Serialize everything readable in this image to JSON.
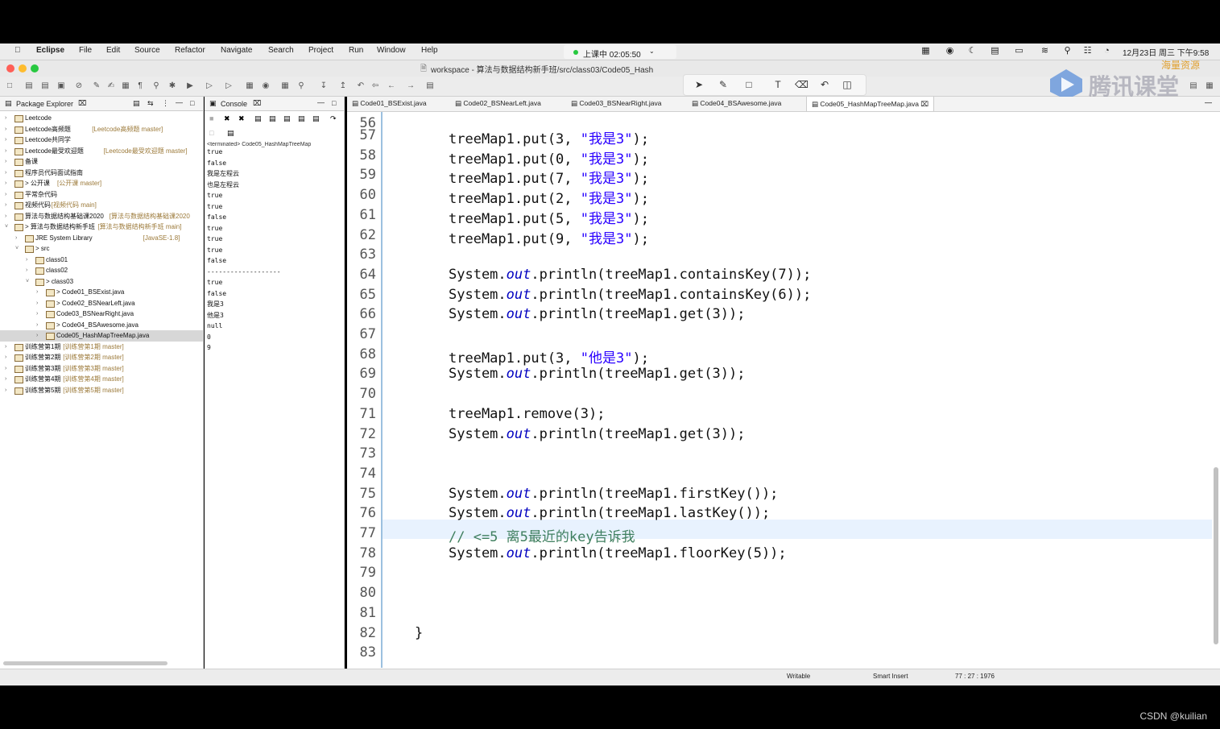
{
  "menubar": {
    "app": "Eclipse",
    "items": [
      "File",
      "Edit",
      "Source",
      "Refactor",
      "Navigate",
      "Search",
      "Project",
      "Run",
      "Window",
      "Help"
    ],
    "clock": "12月23日 周三 下午9:58"
  },
  "recording": {
    "label": "上课中 02:05:50"
  },
  "window": {
    "title": "workspace - 算法与数据结构新手班/src/class03/Code05_Hash"
  },
  "watermark": {
    "brand": "腾讯课堂",
    "sub": "海量资源"
  },
  "package_explorer": {
    "tab_label": "Package Explorer",
    "items": [
      {
        "text": "Leetcode",
        "extra": ""
      },
      {
        "text": "Leetcode高频题",
        "extra": "[Leetcode高频题 master]"
      },
      {
        "text": "Leetcode共同学",
        "extra": ""
      },
      {
        "text": "Leetcode最受欢迎题",
        "extra": "[Leetcode最受欢迎题 master]"
      },
      {
        "text": "备课",
        "extra": ""
      },
      {
        "text": "程序员代码面试指南",
        "extra": ""
      },
      {
        "text": "> 公开课",
        "extra": "[公开课 master]"
      },
      {
        "text": "平常杂代码",
        "extra": ""
      },
      {
        "text": "视频代码",
        "extra": "[视频代码 main]"
      },
      {
        "text": "算法与数据结构基础课2020",
        "extra": "[算法与数据结构基础课2020"
      },
      {
        "text": "> 算法与数据结构新手班",
        "extra": "[算法与数据结构新手班 main]"
      },
      {
        "text": "JRE System Library",
        "extra": "[JavaSE-1.8]"
      },
      {
        "text": "> src",
        "extra": ""
      },
      {
        "text": "class01",
        "extra": ""
      },
      {
        "text": "class02",
        "extra": ""
      },
      {
        "text": "> class03",
        "extra": ""
      },
      {
        "text": "> Code01_BSExist.java",
        "extra": ""
      },
      {
        "text": "> Code02_BSNearLeft.java",
        "extra": ""
      },
      {
        "text": "Code03_BSNearRight.java",
        "extra": ""
      },
      {
        "text": "> Code04_BSAwesome.java",
        "extra": ""
      },
      {
        "text": "Code05_HashMapTreeMap.java",
        "extra": ""
      },
      {
        "text": "训练营第1期",
        "extra": "[训练营第1期 master]"
      },
      {
        "text": "训练营第2期",
        "extra": "[训练营第2期 master]"
      },
      {
        "text": "训练营第3期",
        "extra": "[训练营第3期 master]"
      },
      {
        "text": "训练营第4期",
        "extra": "[训练营第4期 master]"
      },
      {
        "text": "训练营第5期",
        "extra": "[训练营第5期 master]"
      }
    ]
  },
  "console": {
    "tab_label": "Console",
    "header": "<terminated> Code05_HashMapTreeMap",
    "lines": [
      "true",
      "false",
      "我是左程云",
      "也是左程云",
      "true",
      "true",
      "false",
      "true",
      "true",
      "true",
      "false",
      "-------------------",
      "true",
      "false",
      "我是3",
      "他是3",
      "null",
      "0",
      "9"
    ]
  },
  "editor": {
    "tabs": [
      "Code01_BSExist.java",
      "Code02_BSNearLeft.java",
      "Code03_BSNearRight.java",
      "Code04_BSAwesome.java",
      "Code05_HashMapTreeMap.java"
    ],
    "top_line": "56",
    "lines": [
      {
        "n": "57",
        "code": "treeMap1.put(3, \"我是3\");"
      },
      {
        "n": "58",
        "code": "treeMap1.put(0, \"我是3\");"
      },
      {
        "n": "59",
        "code": "treeMap1.put(7, \"我是3\");"
      },
      {
        "n": "60",
        "code": "treeMap1.put(2, \"我是3\");"
      },
      {
        "n": "61",
        "code": "treeMap1.put(5, \"我是3\");"
      },
      {
        "n": "62",
        "code": "treeMap1.put(9, \"我是3\");"
      },
      {
        "n": "63",
        "code": ""
      },
      {
        "n": "64",
        "code": "System.out.println(treeMap1.containsKey(7));"
      },
      {
        "n": "65",
        "code": "System.out.println(treeMap1.containsKey(6));"
      },
      {
        "n": "66",
        "code": "System.out.println(treeMap1.get(3));"
      },
      {
        "n": "67",
        "code": ""
      },
      {
        "n": "68",
        "code": "treeMap1.put(3, \"他是3\");"
      },
      {
        "n": "69",
        "code": "System.out.println(treeMap1.get(3));"
      },
      {
        "n": "70",
        "code": ""
      },
      {
        "n": "71",
        "code": "treeMap1.remove(3);"
      },
      {
        "n": "72",
        "code": "System.out.println(treeMap1.get(3));"
      },
      {
        "n": "73",
        "code": ""
      },
      {
        "n": "74",
        "code": ""
      },
      {
        "n": "75",
        "code": "System.out.println(treeMap1.firstKey());"
      },
      {
        "n": "76",
        "code": "System.out.println(treeMap1.lastKey());"
      },
      {
        "n": "77",
        "code": "// <=5 离5最近的key告诉我"
      },
      {
        "n": "78",
        "code": "System.out.println(treeMap1.floorKey(5));"
      },
      {
        "n": "79",
        "code": ""
      },
      {
        "n": "80",
        "code": ""
      },
      {
        "n": "81",
        "code": ""
      },
      {
        "n": "82",
        "code": "}"
      },
      {
        "n": "83",
        "code": ""
      }
    ]
  },
  "statusbar": {
    "writable": "Writable",
    "insert": "Smart Insert",
    "position": "77 : 27 : 1976"
  },
  "credit": "CSDN @kuilian"
}
